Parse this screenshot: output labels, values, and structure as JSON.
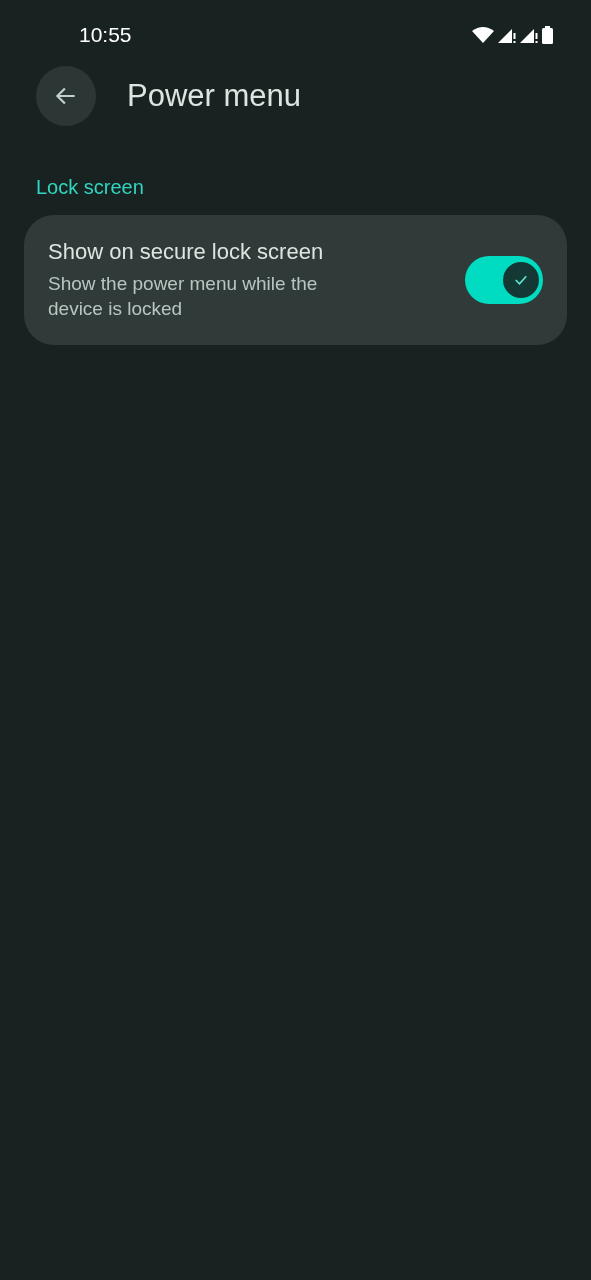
{
  "status_bar": {
    "time": "10:55"
  },
  "app_bar": {
    "title": "Power menu"
  },
  "sections": [
    {
      "header": "Lock screen",
      "items": [
        {
          "title": "Show on secure lock screen",
          "summary": "Show the power menu while the device is locked",
          "on": true
        }
      ]
    }
  ]
}
